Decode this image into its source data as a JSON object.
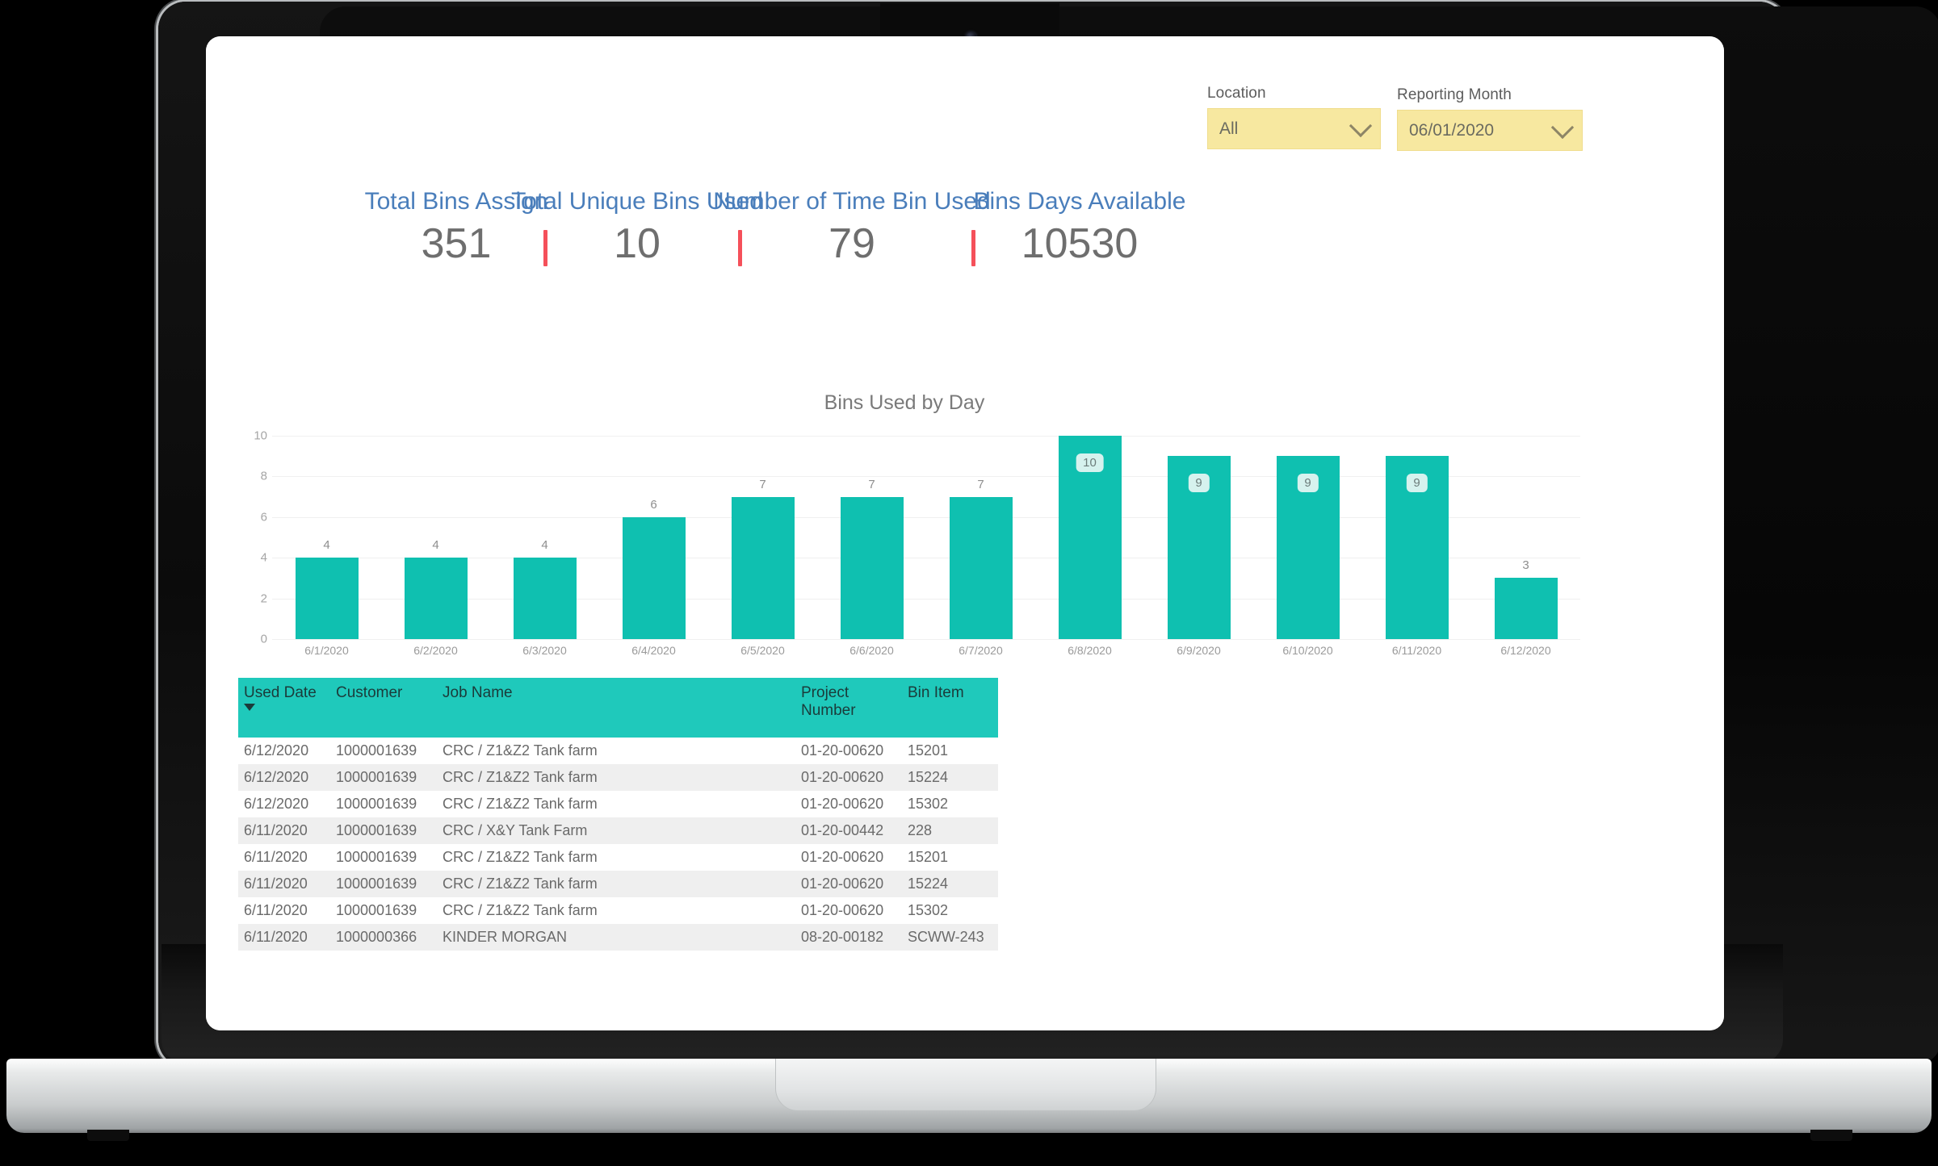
{
  "slicers": {
    "location": {
      "label": "Location",
      "value": "All"
    },
    "month": {
      "label": "Reporting Month",
      "value": "06/01/2020"
    }
  },
  "kpis": [
    {
      "title": "Total Bins Assign",
      "value": "351"
    },
    {
      "title": "Total Unique Bins Used",
      "value": "10"
    },
    {
      "title": "Number of Time Bin Used",
      "value": "79"
    },
    {
      "title": "Bins Days Available",
      "value": "10530"
    }
  ],
  "colors": {
    "kpi_title": "#4a7ebb",
    "kpi_value": "#6e6e6e",
    "separator": "#f5505a",
    "bar": "#0fc0b0",
    "table_header": "#1fc9bb",
    "slicer": "#f7e8a0"
  },
  "chart_data": {
    "type": "bar",
    "title": "Bins Used by Day",
    "xlabel": "",
    "ylabel": "",
    "ylim": [
      0,
      10
    ],
    "yticks": [
      "0",
      "2",
      "4",
      "6",
      "8",
      "10"
    ],
    "grid": true,
    "legend": "none",
    "categories": [
      "6/1/2020",
      "6/2/2020",
      "6/3/2020",
      "6/4/2020",
      "6/5/2020",
      "6/6/2020",
      "6/7/2020",
      "6/8/2020",
      "6/9/2020",
      "6/10/2020",
      "6/11/2020",
      "6/12/2020"
    ],
    "values": [
      4,
      4,
      4,
      6,
      7,
      7,
      7,
      10,
      9,
      9,
      9,
      3
    ],
    "label_style": [
      "outside",
      "outside",
      "outside",
      "outside",
      "outside",
      "outside",
      "outside",
      "inside",
      "inside",
      "inside",
      "inside",
      "outside"
    ]
  },
  "table": {
    "columns": [
      "Used Date",
      "Customer",
      "Job Name",
      "Project Number",
      "Bin Item"
    ],
    "sort_column": "Used Date",
    "sort_direction": "descending",
    "rows": [
      [
        "6/12/2020",
        "1000001639",
        "CRC / Z1&Z2 Tank farm",
        "01-20-00620",
        "15201"
      ],
      [
        "6/12/2020",
        "1000001639",
        "CRC / Z1&Z2 Tank farm",
        "01-20-00620",
        "15224"
      ],
      [
        "6/12/2020",
        "1000001639",
        "CRC / Z1&Z2 Tank farm",
        "01-20-00620",
        "15302"
      ],
      [
        "6/11/2020",
        "1000001639",
        "CRC / X&Y Tank Farm",
        "01-20-00442",
        "228"
      ],
      [
        "6/11/2020",
        "1000001639",
        "CRC / Z1&Z2 Tank farm",
        "01-20-00620",
        "15201"
      ],
      [
        "6/11/2020",
        "1000001639",
        "CRC / Z1&Z2 Tank farm",
        "01-20-00620",
        "15224"
      ],
      [
        "6/11/2020",
        "1000001639",
        "CRC / Z1&Z2 Tank farm",
        "01-20-00620",
        "15302"
      ],
      [
        "6/11/2020",
        "1000000366",
        "KINDER MORGAN",
        "08-20-00182",
        "SCWW-243"
      ]
    ]
  }
}
